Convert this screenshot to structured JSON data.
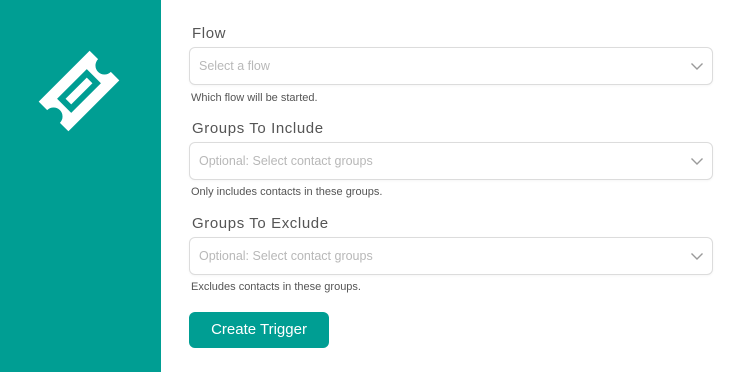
{
  "sidebar": {
    "icon": "ticket-icon",
    "color": "#009e93"
  },
  "fields": [
    {
      "label": "Flow",
      "placeholder": "Select a flow",
      "help": "Which flow will be started."
    },
    {
      "label": "Groups To Include",
      "placeholder": "Optional: Select contact groups",
      "help": "Only includes contacts in these groups."
    },
    {
      "label": "Groups To Exclude",
      "placeholder": "Optional: Select contact groups",
      "help": "Excludes contacts in these groups."
    }
  ],
  "actions": {
    "submit_label": "Create Trigger"
  },
  "colors": {
    "accent": "#009e93",
    "label": "#555555",
    "placeholder": "#b8b8b8",
    "border": "#dcdcdc"
  }
}
